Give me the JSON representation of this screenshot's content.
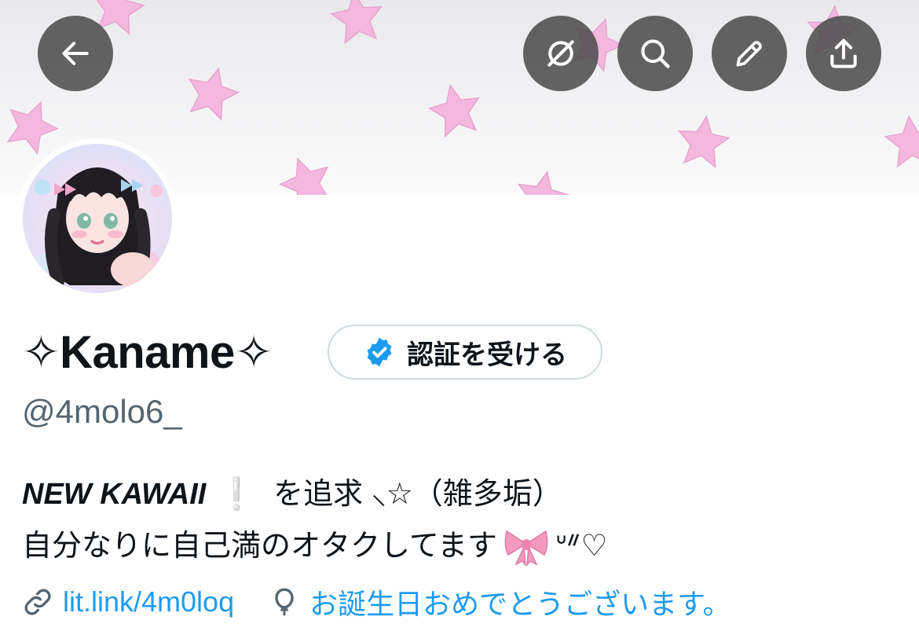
{
  "header": {
    "back_icon": "arrow-left-icon",
    "actions": [
      {
        "icon": "grok-icon"
      },
      {
        "icon": "search-icon"
      },
      {
        "icon": "pencil-icon"
      },
      {
        "icon": "share-icon"
      }
    ]
  },
  "profile": {
    "display_name": "✧Kaname✧",
    "handle": "@4molo6_",
    "verify_button": "認証を受ける",
    "bio_line1_emphasis": "NEW KAWAII",
    "bio_line1_excl": "❕",
    "bio_line1_rest": "を追求 ⸜☆（雑多垢）",
    "bio_line2_text": "自分なりに自己満のオタクしてます",
    "bio_line2_tail": "ᐡᐥ♡",
    "link": "lit.link/4m0loq",
    "birthday": "お誕生日おめでとうございます。"
  },
  "colors": {
    "accent": "#1d9bf0",
    "banner_stars": "#f4b8df",
    "button_overlay": "#4d4d4d",
    "muted_text": "#536471"
  }
}
